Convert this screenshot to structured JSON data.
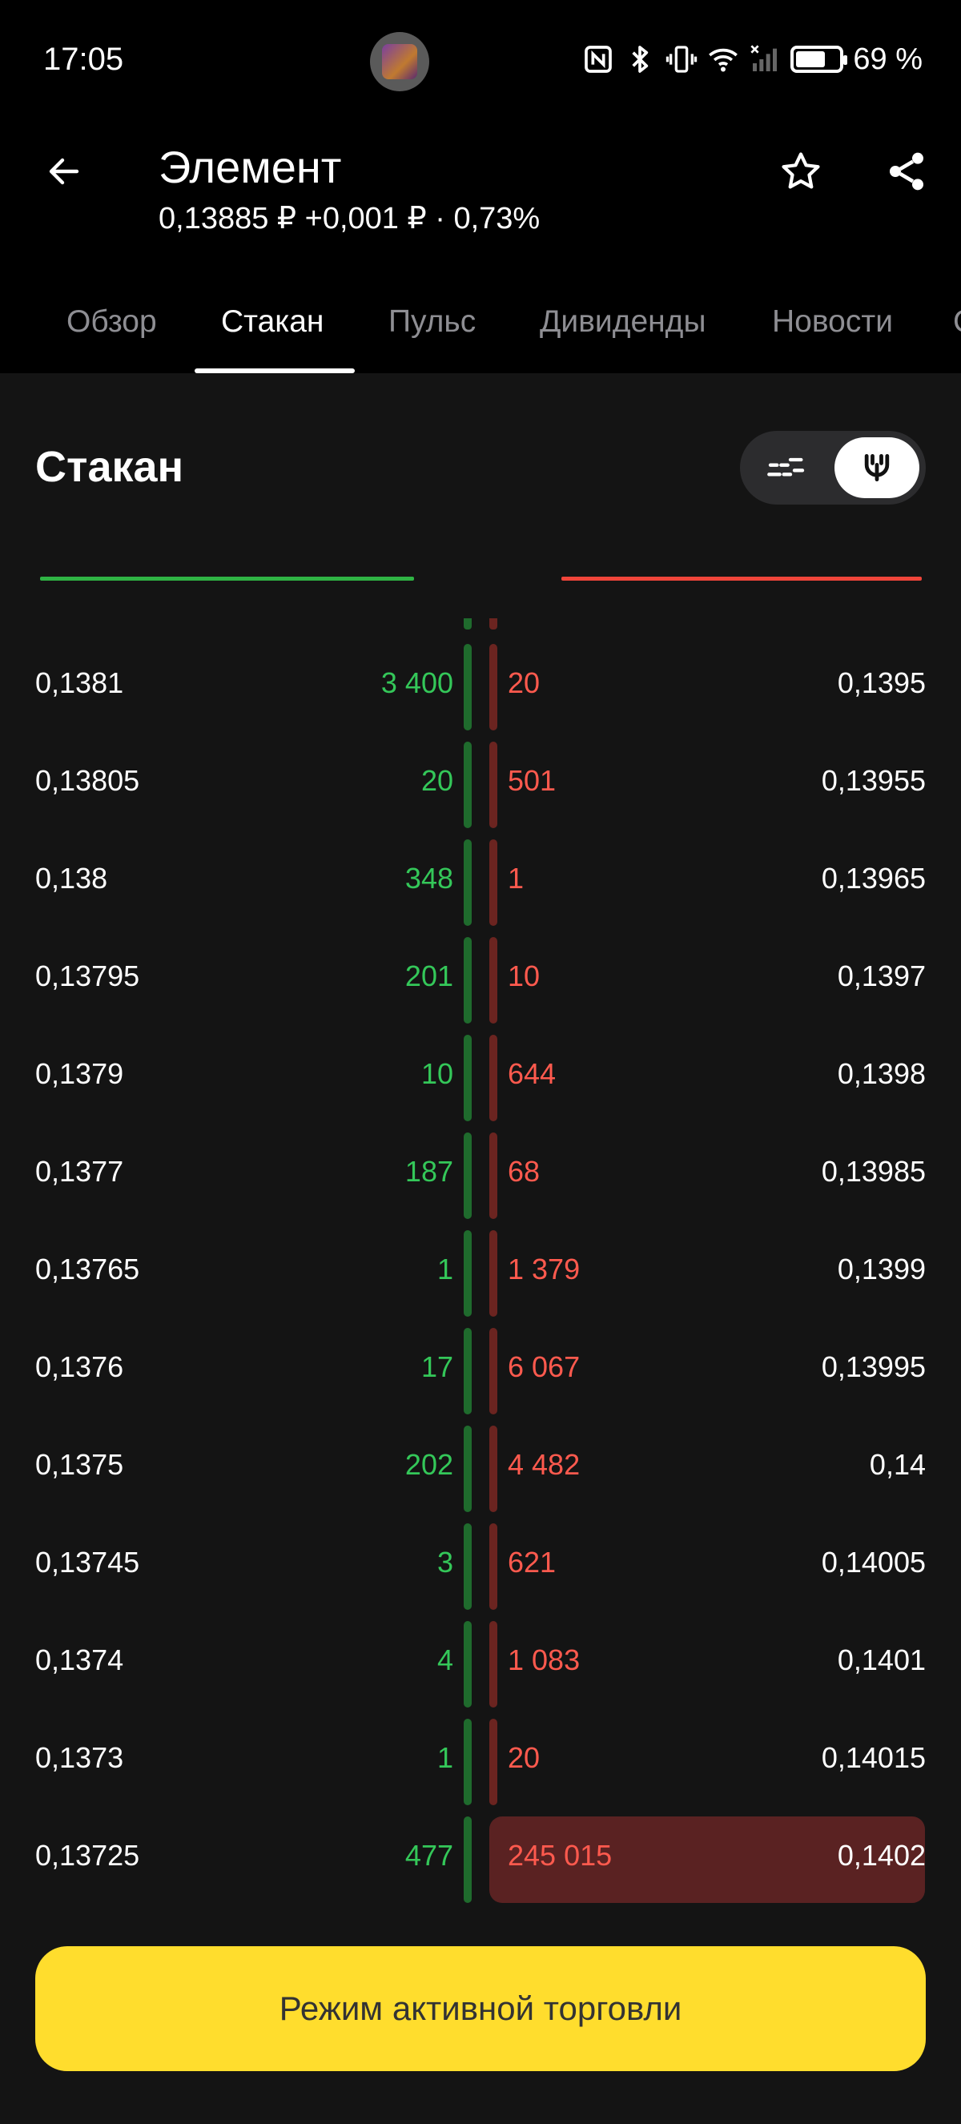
{
  "status_bar": {
    "time": "17:05",
    "battery_percent_label": "69 %",
    "battery_level": 0.69,
    "icons": [
      "nfc-icon",
      "bluetooth-icon",
      "vibrate-icon",
      "wifi-icon",
      "signal-icon",
      "battery-icon"
    ]
  },
  "header": {
    "title": "Элемент",
    "subtitle": "0,13885 ₽  +0,001 ₽ · 0,73%",
    "back_icon": "arrow-left-icon",
    "star_icon": "star-icon",
    "share_icon": "share-icon"
  },
  "tabs": [
    {
      "label": "Обзор",
      "active": false
    },
    {
      "label": "Стакан",
      "active": true
    },
    {
      "label": "Пульс",
      "active": false
    },
    {
      "label": "Дивиденды",
      "active": false
    },
    {
      "label": "Новости",
      "active": false
    },
    {
      "label": "С",
      "active": false
    }
  ],
  "orderbook": {
    "title": "Стакан",
    "rows": [
      {
        "bid_price": "0,1381",
        "bid_qty": "3 400",
        "ask_qty": "20",
        "ask_price": "0,1395"
      },
      {
        "bid_price": "0,13805",
        "bid_qty": "20",
        "ask_qty": "501",
        "ask_price": "0,13955"
      },
      {
        "bid_price": "0,138",
        "bid_qty": "348",
        "ask_qty": "1",
        "ask_price": "0,13965"
      },
      {
        "bid_price": "0,13795",
        "bid_qty": "201",
        "ask_qty": "10",
        "ask_price": "0,1397"
      },
      {
        "bid_price": "0,1379",
        "bid_qty": "10",
        "ask_qty": "644",
        "ask_price": "0,1398"
      },
      {
        "bid_price": "0,1377",
        "bid_qty": "187",
        "ask_qty": "68",
        "ask_price": "0,13985"
      },
      {
        "bid_price": "0,13765",
        "bid_qty": "1",
        "ask_qty": "1 379",
        "ask_price": "0,1399"
      },
      {
        "bid_price": "0,1376",
        "bid_qty": "17",
        "ask_qty": "6 067",
        "ask_price": "0,13995"
      },
      {
        "bid_price": "0,1375",
        "bid_qty": "202",
        "ask_qty": "4 482",
        "ask_price": "0,14"
      },
      {
        "bid_price": "0,13745",
        "bid_qty": "3",
        "ask_qty": "621",
        "ask_price": "0,14005"
      },
      {
        "bid_price": "0,1374",
        "bid_qty": "4",
        "ask_qty": "1 083",
        "ask_price": "0,1401"
      },
      {
        "bid_price": "0,1373",
        "bid_qty": "1",
        "ask_qty": "20",
        "ask_price": "0,14015"
      },
      {
        "bid_price": "0,13725",
        "bid_qty": "477",
        "ask_qty": "245 015",
        "ask_price": "0,1402",
        "highlight": true
      }
    ]
  },
  "actions": {
    "trade_button_label": "Режим активной торговли"
  },
  "colors": {
    "bid": "#34c759",
    "ask": "#ff5a4e",
    "accent": "#ffdd2d"
  }
}
